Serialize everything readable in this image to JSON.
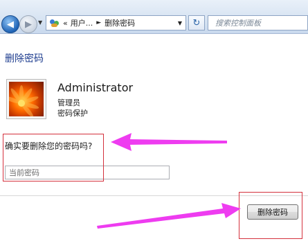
{
  "toolbar": {
    "breadcrumb_lead": "«",
    "breadcrumb_parent": "用户...",
    "breadcrumb_sep": "►",
    "breadcrumb_current": "删除密码",
    "dropdown_glyph": "▼",
    "refresh_glyph": "↻",
    "search_placeholder": "搜索控制面板",
    "icons": [
      "back-arrow-icon",
      "forward-arrow-icon",
      "users-icon",
      "refresh-icon"
    ]
  },
  "page": {
    "title": "删除密码"
  },
  "user": {
    "name": "Administrator",
    "role": "管理员",
    "protection": "密码保护"
  },
  "form": {
    "question": "确实要删除您的密码吗?",
    "password_placeholder": "当前密码",
    "delete_button": "删除密码"
  },
  "annotations": {
    "arrow_color": "#ee3cf0",
    "highlight_color": "#d4303c"
  }
}
